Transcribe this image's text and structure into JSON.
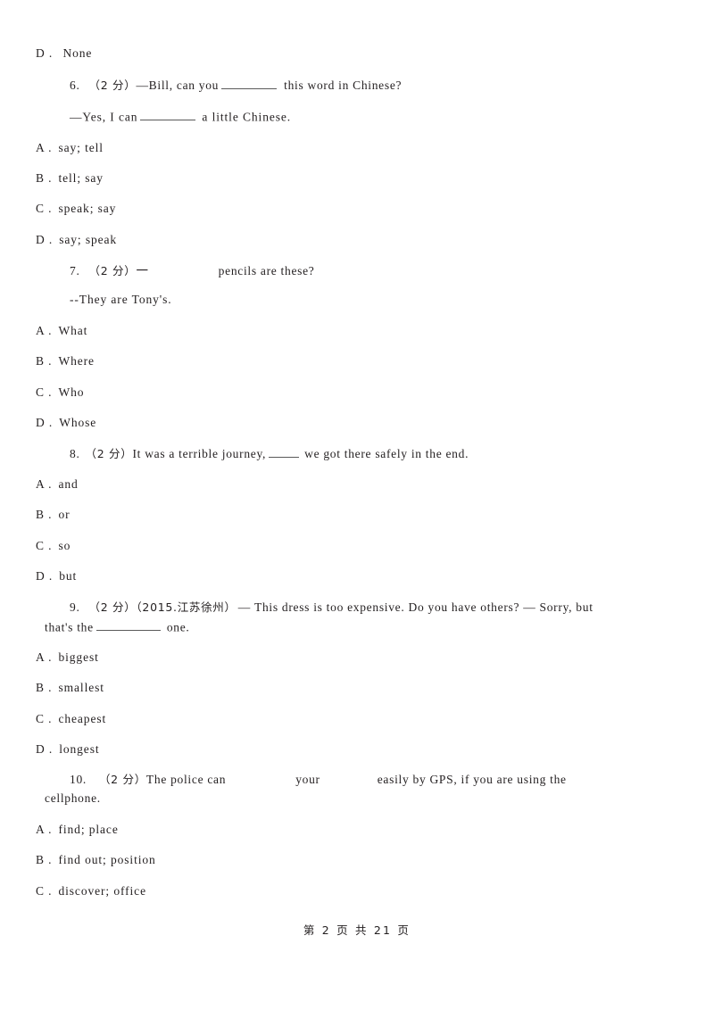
{
  "document": {
    "type": "exam-worksheet",
    "language": "en-zh",
    "background_color": "#ffffff",
    "text_color": "#231f20"
  },
  "carryover_option": {
    "label": "D .",
    "text": "None"
  },
  "questions": [
    {
      "number": "6.",
      "marks": "（2 分）",
      "stem": "—Bill, can you",
      "stem_after_blank": "this word in Chinese?",
      "reply": "—Yes, I can",
      "reply_after_blank": "a little Chinese.",
      "options": [
        {
          "label": "A .",
          "text": "say; tell"
        },
        {
          "label": "B .",
          "text": "tell; say"
        },
        {
          "label": "C .",
          "text": "speak; say"
        },
        {
          "label": "D .",
          "text": "say; speak"
        }
      ]
    },
    {
      "number": "7.",
      "marks": "（2 分）",
      "stem": "一",
      "stem_after_blank": "pencils are these?",
      "reply": "--They are Tony's.",
      "options": [
        {
          "label": "A .",
          "text": "What"
        },
        {
          "label": "B .",
          "text": "Where"
        },
        {
          "label": "C .",
          "text": "Who"
        },
        {
          "label": "D .",
          "text": "Whose"
        }
      ]
    },
    {
      "number": "8.",
      "marks": "（2 分）",
      "stem": "It was a terrible journey,",
      "stem_after_blank": "we got there safely in the end.",
      "options": [
        {
          "label": "A .",
          "text": "and"
        },
        {
          "label": "B .",
          "text": "or"
        },
        {
          "label": "C .",
          "text": "so"
        },
        {
          "label": "D .",
          "text": "but"
        }
      ]
    },
    {
      "number": "9.",
      "marks": "（2 分）",
      "source": "（2015.江苏徐州）",
      "stem": "— This dress is too expensive. Do you have others?  — Sorry, but",
      "stem_line2_before": "that's the",
      "stem_line2_after": "one.",
      "options": [
        {
          "label": "A .",
          "text": "biggest"
        },
        {
          "label": "B .",
          "text": "smallest"
        },
        {
          "label": "C .",
          "text": "cheapest"
        },
        {
          "label": "D .",
          "text": "longest"
        }
      ]
    },
    {
      "number": "10.",
      "marks": "（2 分）",
      "stem": "The police can",
      "stem_mid": "your",
      "stem_after": "easily by GPS, if you are using the",
      "stem_line2": "cellphone.",
      "options": [
        {
          "label": "A .",
          "text": "find; place"
        },
        {
          "label": "B .",
          "text": "find out; position"
        },
        {
          "label": "C .",
          "text": "discover; office"
        }
      ]
    }
  ],
  "footer": {
    "text": "第 2 页 共 21 页",
    "page_number": "2",
    "total_pages": "21"
  }
}
